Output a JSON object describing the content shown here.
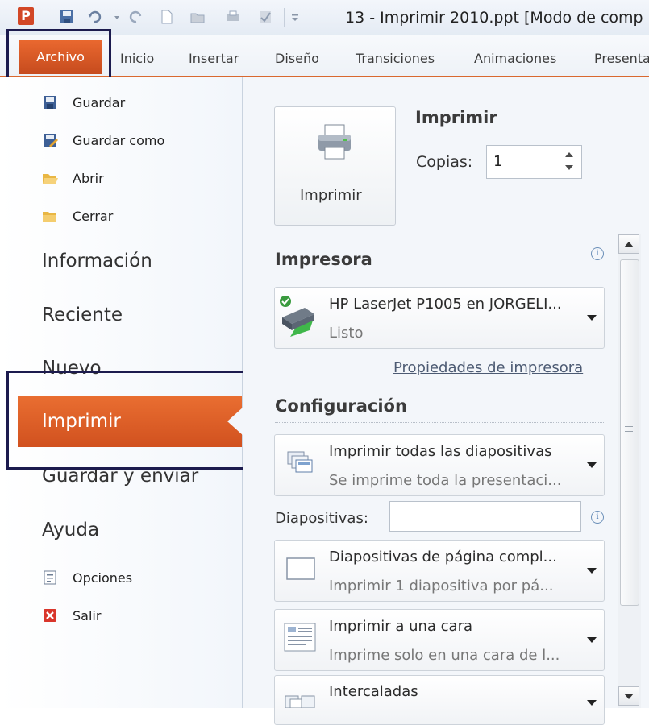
{
  "window": {
    "app_letter": "P",
    "title": "13 - Imprimir 2010.ppt [Modo de comp"
  },
  "ribbon": {
    "tabs": [
      "Archivo",
      "Inicio",
      "Insertar",
      "Diseño",
      "Transiciones",
      "Animaciones",
      "Presenta"
    ]
  },
  "backstage_nav": {
    "commands": [
      {
        "label": "Guardar",
        "icon": "save-icon"
      },
      {
        "label": "Guardar como",
        "icon": "save-as-icon"
      },
      {
        "label": "Abrir",
        "icon": "open-folder-icon"
      },
      {
        "label": "Cerrar",
        "icon": "close-folder-icon"
      }
    ],
    "sections": [
      "Información",
      "Reciente",
      "Nuevo",
      "Imprimir",
      "Guardar y enviar",
      "Ayuda"
    ],
    "selected": "Imprimir",
    "footer": [
      {
        "label": "Opciones",
        "icon": "options-icon"
      },
      {
        "label": "Salir",
        "icon": "exit-icon"
      }
    ]
  },
  "print": {
    "button_label": "Imprimir",
    "heading": "Imprimir",
    "copies_label": "Copias:",
    "copies_value": "1"
  },
  "printer": {
    "heading": "Impresora",
    "name": "HP LaserJet P1005 en JORGELI...",
    "status": "Listo",
    "properties_link": "Propiedades de impresora"
  },
  "settings": {
    "heading": "Configuración",
    "slides_label": "Diapositivas:",
    "slides_value": "",
    "options": [
      {
        "main": "Imprimir todas las diapositivas",
        "sub": "Se imprime toda la presentaci...",
        "icon": "slides-stack-icon"
      },
      {
        "main": "Diapositivas de página compl...",
        "sub": "Imprimir 1 diapositiva por pá...",
        "icon": "full-page-slide-icon"
      },
      {
        "main": "Imprimir a una cara",
        "sub": "Imprime solo en una cara de l...",
        "icon": "one-sided-icon"
      },
      {
        "main": "Intercaladas",
        "sub": "",
        "icon": "collated-icon"
      }
    ]
  },
  "colors": {
    "accent": "#d9622b",
    "outline": "#1c1b4e"
  }
}
